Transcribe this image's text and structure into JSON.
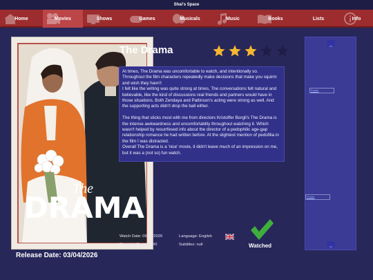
{
  "window": {
    "title": "Shai's Space"
  },
  "nav": [
    {
      "label": "Home",
      "icon": "home-icon"
    },
    {
      "label": "Movies",
      "icon": "film-camera-icon",
      "active": true
    },
    {
      "label": "Shows",
      "icon": "tv-icon"
    },
    {
      "label": "Games",
      "icon": "gamepad-icon"
    },
    {
      "label": "Musicals",
      "icon": "masks-icon"
    },
    {
      "label": "Music",
      "icon": "music-note-icon"
    },
    {
      "label": "Books",
      "icon": "books-icon"
    },
    {
      "label": "Lists",
      "icon": "list-icon"
    },
    {
      "label": "Info",
      "icon": "info-icon"
    }
  ],
  "movie": {
    "title": "The Drama",
    "poster": {
      "small_text": "The",
      "big_text": "DRAMA"
    },
    "rating": {
      "value": 3,
      "max": 5,
      "filled_color": "#f5b82e",
      "empty_color": "#1d1d48"
    },
    "review": "At times, The Drama was uncomfortable to watch, and intentionally so. Throughout the film characters repeatedly make decisions that make you squirm and wish they havn't\nI felt like the writing was quite strong at times, The conversations felt natural and believable, like the kind of discussions real friends and partners would have in those situations. Both Zendaya and Pattinson's acting were strong as well. And the supporting acts didn't drop the ball either.\n\nThe thing that sticks most with me from directors Kristoffer Borgli's The Drama is the intense awkwardness and uncomfortablity throughout watching it. Which wasn't helped by resurrfesed info about the director of a pedophilic age-gap relationship romance he had written before. At the slightest mention of pedofilia in the film I was distracted.\nOverall The Drama is a 'nice' movie, it didn't leave much of an impression on me, but it was a (not so) fun watch.",
    "watch_date": "Watch Date: 09/07/2026",
    "rewatch_counter": "Rewatch Counter: #0",
    "language": "Language: English",
    "subtitles": "Subtitles: null",
    "flag_icon": "uk-flag-icon",
    "status_icon": "checkmark-icon",
    "status": "Watched",
    "status_color": "#3fae3c",
    "release_date": "Release Date: 03/04/2026"
  },
  "sidebar": {
    "up_icon": "arrow-up-icon",
    "down_icon": "arrow-down-icon",
    "images": [
      {
        "alt": "Poster"
      },
      {
        "alt": "Poster"
      }
    ]
  }
}
